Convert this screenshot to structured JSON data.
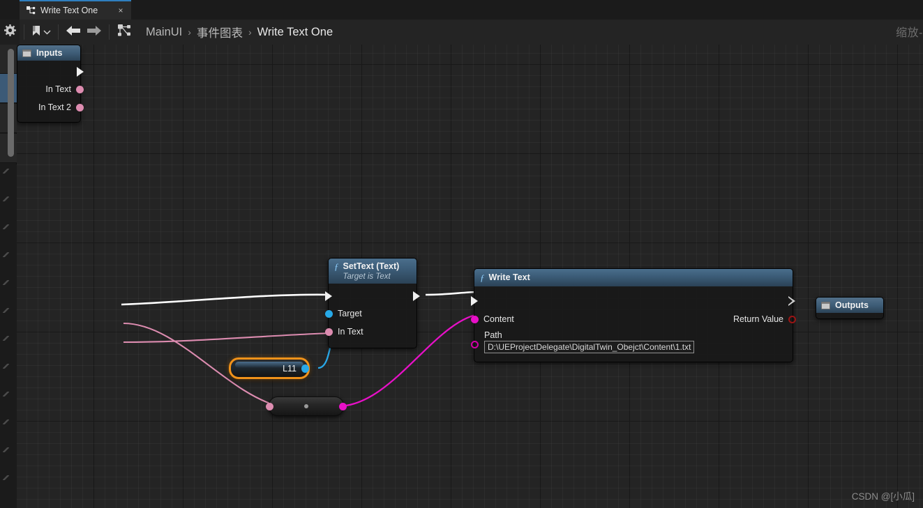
{
  "window": {
    "tab": {
      "label": "Write Text One",
      "close": "×",
      "icon": "blueprint-graph-icon"
    }
  },
  "toolbar": {
    "gear_icon": "gear-icon",
    "bookmark_icon": "bookmark-icon",
    "chevron_icon": "chevron-down-icon",
    "back_icon": "back-arrow-icon",
    "forward_icon": "forward-arrow-icon",
    "graph_icon": "blueprint-graph-icon",
    "breadcrumb": [
      {
        "label": "MainUI"
      },
      {
        "label": "事件图表"
      },
      {
        "label": "Write Text One"
      }
    ],
    "breadcrumb_separator": "›"
  },
  "canvas": {
    "zoom_label": "缩放-",
    "watermark": "CSDN @[小瓜]"
  },
  "nodes": {
    "inputs": {
      "title": "Inputs",
      "pins": [
        {
          "label": "In Text",
          "color": "#dd8cb0"
        },
        {
          "label": "In Text 2",
          "color": "#dd8cb0"
        }
      ]
    },
    "settext": {
      "title": "SetText (Text)",
      "subtitle": "Target is Text",
      "fn_glyph": "ƒ",
      "pins": [
        {
          "label": "Target",
          "color": "#27a9e8"
        },
        {
          "label": "In Text",
          "color": "#dd8cb0"
        }
      ]
    },
    "writetext": {
      "title": "Write Text",
      "fn_glyph": "ƒ",
      "content_label": "Content",
      "content_color": "#e810c8",
      "path_label": "Path",
      "path_value": "D:\\UEProjectDelegate\\DigitalTwin_Obejct\\Content\\1.txt",
      "return_label": "Return Value",
      "return_color": "#9b1414"
    },
    "variable": {
      "label": "L11",
      "pin_color": "#29a8e8"
    },
    "convert": {
      "in_color": "#dd8cb0",
      "out_color": "#e810c8"
    },
    "outputs": {
      "title": "Outputs"
    }
  },
  "colors": {
    "exec_wire": "#ffffff",
    "text_wire": "#dd8cb0",
    "magenta_wire": "#e810c8",
    "object_wire": "#29a8e8",
    "selection": "#f0921a",
    "tab_accent": "#2f7fbf"
  }
}
